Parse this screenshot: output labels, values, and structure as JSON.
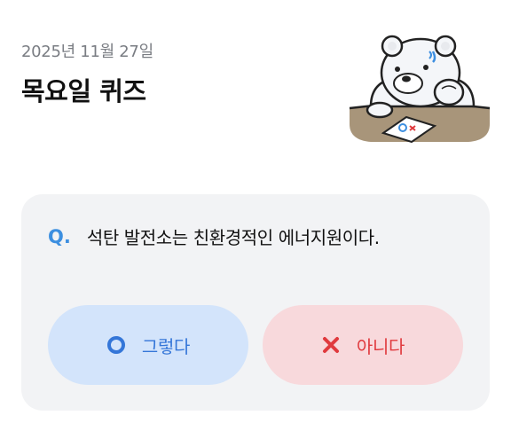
{
  "header": {
    "date": "2025년 11월 27일",
    "title": "목요일 퀴즈"
  },
  "mascot": {
    "icon": "bear-thinking-icon",
    "paper_marks": "OX"
  },
  "quiz": {
    "question_mark": "Q.",
    "question": "석탄 발전소는 친환경적인 에너지원이다.",
    "options": [
      {
        "icon": "circle-o-icon",
        "label": "그렇다",
        "color": "#3476d8",
        "bg": "#d3e4fb"
      },
      {
        "icon": "cross-x-icon",
        "label": "아니다",
        "color": "#e03a3e",
        "bg": "#f8d9dc"
      }
    ]
  },
  "colors": {
    "card_bg": "#f2f3f5",
    "accent_blue": "#3d8fe0"
  }
}
